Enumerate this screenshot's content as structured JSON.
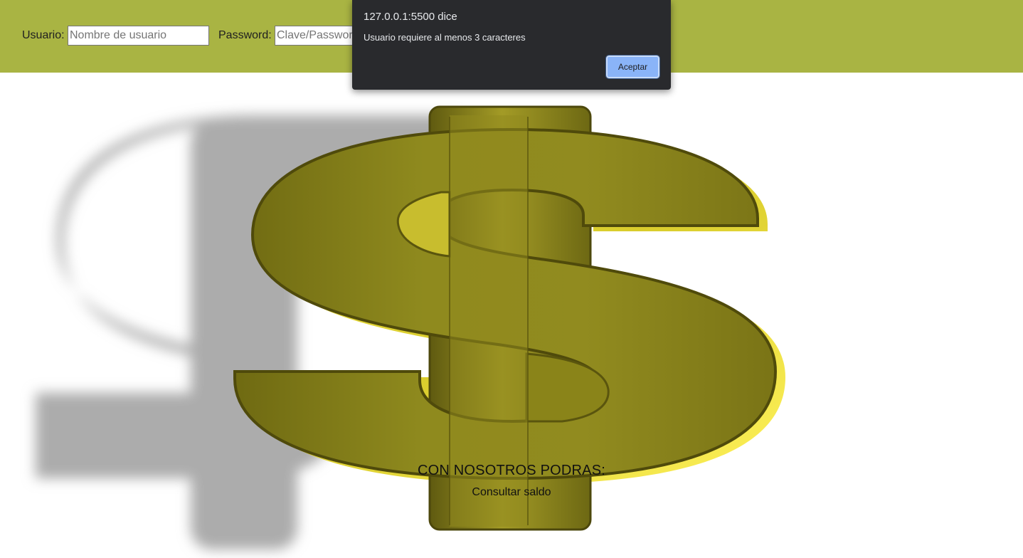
{
  "login": {
    "user_label": "Usuario:",
    "user_value": "",
    "user_placeholder": "Nombre de usuario",
    "password_label": "Password:",
    "password_value": "",
    "password_placeholder": "Clave/Password"
  },
  "hero": {
    "image": "gold-dollar-sign-icon"
  },
  "promo": {
    "title": "CON NOSOTROS PODRAS:",
    "items": [
      "Consultar saldo"
    ]
  },
  "alert": {
    "origin": "127.0.0.1:5500 dice",
    "message": "Usuario requiere al menos 3 caracteres",
    "ok_label": "Aceptar"
  },
  "colors": {
    "topbar": "#a9b443",
    "dialog_bg": "#292a2d",
    "dialog_button": "#8ab4f8",
    "gold": "#9a9220"
  }
}
